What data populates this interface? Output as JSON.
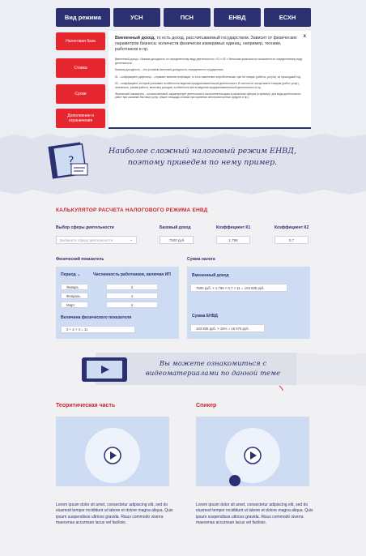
{
  "tabs": [
    "Вид режима",
    "УСН",
    "ПСН",
    "ЕНВД",
    "ЕСХН"
  ],
  "side_buttons": [
    "Налоговая база",
    "Ставка",
    "Сроки",
    "Дополнения и ограничения"
  ],
  "panel": {
    "close": "x",
    "lead_bold": "Вмененный доход,",
    "lead_rest": " то есть доход, рассчитываемый государством. Зависит от физических параметров бизнеса: количеств физически измеримых единиц, например, техники, работников и пр.",
    "lines": [
      "Вмененный доход = базовая доходность по определенному виду деятельности × К1 × К2 × Величина физического показателя по определенному виду деятельности",
      "Базовая доходность – это условная величина доходности, определяется государством.",
      "К1 – коэффициент-дефлятор – отражает влияние инфляции, то есть изменения потребительских цен на товары (работы, услуги), за прошедший год.",
      "К2 – коэффициент, который учитывает особенности ведения предпринимательской деятельности. В частности, ассортимент товаров (работ, услуг), сезонность, режим работы, величину доходов, особенности места ведения предпринимательской деятельности и пр.",
      "Физический показатель – количественный, характеризует деятельность налогоплательщика в различных сферах (к примеру: для вида деятельности работ при оказании бытовых услуг, общее площадь стоянки при хранении автотранспортных средств и пр.)"
    ]
  },
  "banner": {
    "text": "Наиболее сложный налоговый режим ЕНВД, поэтому приведем по нему пример."
  },
  "calculator": {
    "title": "КАЛЬКУЛЯТОР РАСЧЕТА НАЛОГОВОГО РЕЖИМА ЕНВД",
    "activity_label": "Выбор сферы деятельности",
    "activity_placeholder": "Выберите сферу деятельности",
    "base_label": "Базовый доход",
    "base_value": "7500 руб",
    "k1_label": "Коэффициент К1",
    "k1_value": "1,798",
    "k2_label": "Коэффициент К2",
    "k2_value": "0,7",
    "physical_label": "Физический показатель",
    "period_header": "Период",
    "count_header": "Численность работников, включая ИП",
    "rows": [
      {
        "month": "Январь",
        "count": "3"
      },
      {
        "month": "Февраль",
        "count": "4"
      },
      {
        "month": "Март",
        "count": "4"
      }
    ],
    "magnitude_label": "Величина физического показателя",
    "magnitude_value": "3 + 4 + 4 = 11",
    "tax_sum_label": "Сумма налога",
    "imputed_label": "Вмененный доход",
    "imputed_value": "7500 руб. × 1,798 × 0,7 × 11 = 103 835 руб.",
    "envd_label": "Сумма ЕНВД",
    "envd_value": "103 835 руб. × 15% = 15 575 руб."
  },
  "video_banner": {
    "text": "Вы можете ознакомиться с видеоматериалами по данной теме"
  },
  "sections": [
    {
      "title": "Теоритическая часть",
      "text": "Lorem ipsum dolor sit amet, consectetur adipiscing elit, sed do eiusmod tempor incididunt ut labore et dolore magna aliqua. Quis ipsum suspendisse ultrices gravida. Risus commodo viverra maecenas accumsan lacus vel facilisis."
    },
    {
      "title": "Спикер",
      "text": "Lorem ipsum dolor sit amet, consectetur adipiscing elit, sed do eiusmod tempor incididunt ut labore et dolore magna aliqua. Quis ipsum suspendisse ultrices gravida. Risus commodo viverra maecenas accumsan lacus vel facilisis."
    }
  ],
  "colors": {
    "navy": "#2b3170",
    "red": "#e6262f",
    "light_blue": "#cddcf3"
  }
}
